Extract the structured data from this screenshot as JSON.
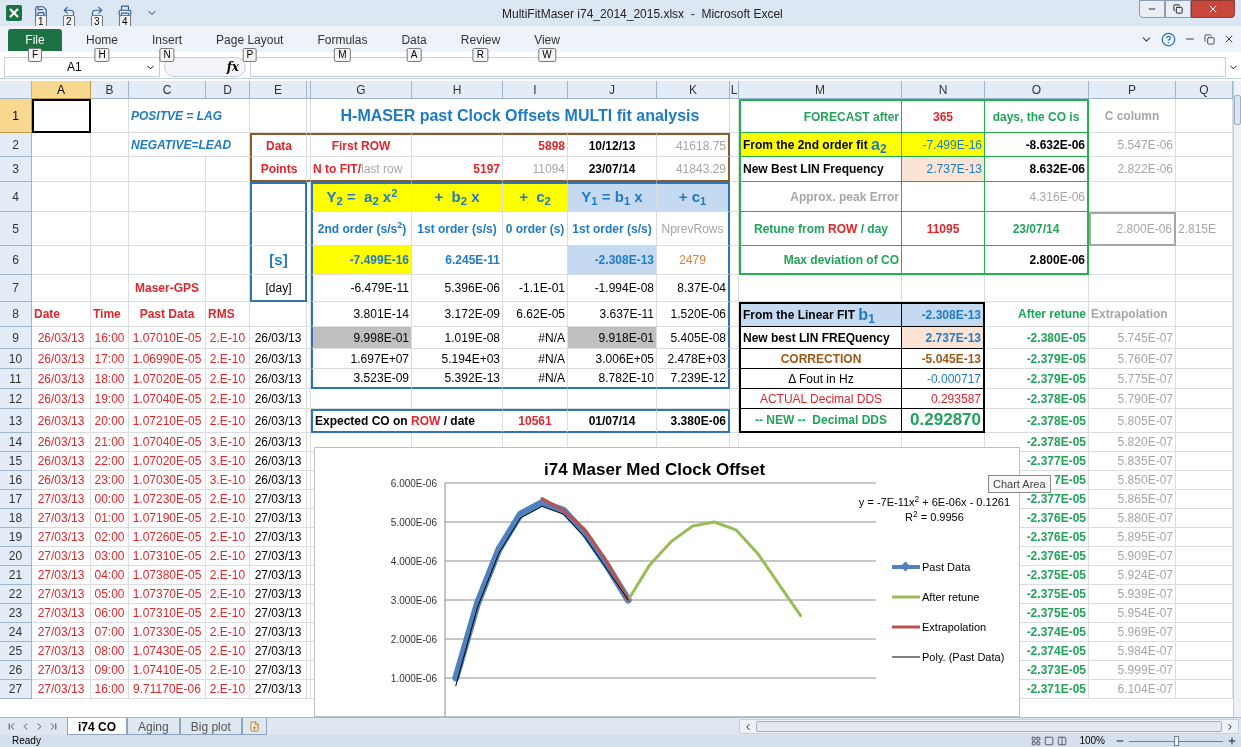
{
  "window": {
    "title": "MultiFitMaser i74_2014_2015.xlsx  -  Microsoft Excel"
  },
  "quick_access": [
    {
      "keytip": "1"
    },
    {
      "keytip": "2"
    },
    {
      "keytip": "3"
    },
    {
      "keytip": "4"
    }
  ],
  "ribbon_tabs": [
    {
      "label": "File",
      "keytip": "F",
      "kind": "file"
    },
    {
      "label": "Home",
      "keytip": "H",
      "kind": "tab"
    },
    {
      "label": "Insert",
      "keytip": "N",
      "kind": "tab"
    },
    {
      "label": "Page Layout",
      "keytip": "P",
      "kind": "tab"
    },
    {
      "label": "Formulas",
      "keytip": "M",
      "kind": "tab"
    },
    {
      "label": "Data",
      "keytip": "A",
      "kind": "tab"
    },
    {
      "label": "Review",
      "keytip": "R",
      "kind": "tab"
    },
    {
      "label": "View",
      "keytip": "W",
      "kind": "tab"
    }
  ],
  "name_box": "A1",
  "function_button": "fx",
  "columns": [
    {
      "label": "A",
      "selected": true
    },
    {
      "label": "B",
      "selected": false
    },
    {
      "label": "C",
      "selected": false
    },
    {
      "label": "D",
      "selected": false
    },
    {
      "label": "E",
      "selected": false
    },
    {
      "label": "G",
      "selected": false
    },
    {
      "label": "H",
      "selected": false
    },
    {
      "label": "I",
      "selected": false
    },
    {
      "label": "J",
      "selected": false
    },
    {
      "label": "K",
      "selected": false
    },
    {
      "label": "L",
      "selected": false
    },
    {
      "label": "M",
      "selected": false
    },
    {
      "label": "N",
      "selected": false
    },
    {
      "label": "O",
      "selected": false
    },
    {
      "label": "P",
      "selected": false
    },
    {
      "label": "Q",
      "selected": false
    }
  ],
  "rows": [
    {
      "number": "1",
      "selected": true,
      "cells": {
        "C": "POSITVE = LAG",
        "G": "H-MASER past Clock Offsets MULTI fit analysis",
        "M": "FORECAST after",
        "N": "365",
        "O": "days, the CO is",
        "P": "C column"
      }
    },
    {
      "number": "2",
      "selected": false,
      "cells": {
        "C": "NEGATIVE=LEAD",
        "E": "Data",
        "G": "First ROW",
        "I": "5898",
        "J": "10/12/13",
        "K": "41618.75",
        "M": [
          "From the 2nd order fit ",
          "a$_{2}$"
        ],
        "N": "-7.499E-16",
        "O": "-8.632E-06",
        "P": "5.547E-06"
      }
    },
    {
      "number": "3",
      "selected": false,
      "cells": {
        "E": "Points",
        "G": [
          "N to FIT/",
          "last row"
        ],
        "H": "5197",
        "I": "11094",
        "J": "23/07/14",
        "K": "41843.29",
        "M": "New Best LIN Frequency",
        "N": "2.737E-13",
        "O": "8.632E-06",
        "P": "2.822E-06"
      }
    },
    {
      "number": "4",
      "selected": false,
      "cells": {
        "G": "Y$_{2}$ =  a$_{2}$ x$^{2}$",
        "H": "+  b$_{2}$ x",
        "I": "+  c$_{2}$",
        "J": "Y$_{1}$ = b$_{1}$ x",
        "K": "+ c$_{1}$",
        "M": "Approx. peak Error",
        "O": "4.316E-06"
      }
    },
    {
      "number": "5",
      "selected": false,
      "cells": {
        "G": "2nd order (s/s$^{2}$)",
        "H": "1st order (s/s)",
        "I": "0 order (s)",
        "J": "1st order (s/s)",
        "K": "NprevRows",
        "M": [
          "Retune from ",
          "ROW",
          " / day"
        ],
        "N": "11095",
        "O": "23/07/14",
        "P": "2.800E-06",
        "Q": "2.815E"
      }
    },
    {
      "number": "6",
      "selected": false,
      "cells": {
        "E": "[s]",
        "G": "-7.499E-16",
        "H": "6.245E-11",
        "J": "-2.308E-13",
        "K": "2479",
        "M": "Max deviation of CO",
        "O": "2.800E-06"
      }
    },
    {
      "number": "7",
      "selected": false,
      "cells": {
        "C": "Maser-GPS",
        "E": "[day]",
        "G": "-6.479E-11",
        "H": "5.396E-06",
        "I": "-1.1E-01",
        "J": "-1.994E-08",
        "K": "8.37E-04"
      }
    },
    {
      "number": "8",
      "selected": false,
      "cells": {
        "A": "Date",
        "B": "Time",
        "C": "Past Data",
        "D": "RMS",
        "G": "3.801E-14",
        "H": "3.172E-09",
        "I": "6.62E-05",
        "J": "3.637E-11",
        "K": "1.520E-06",
        "M": [
          "From the Linear FIT ",
          "b$_{1}$"
        ],
        "N": "-2.308E-13",
        "O": "After retune",
        "P": "Extrapolation"
      }
    },
    {
      "number": "9",
      "selected": false,
      "cells": {
        "A": "26/03/13",
        "B": "16:00",
        "C": "1.07010E-05",
        "D": "2.E-10",
        "E": "26/03/13",
        "G": "9.998E-01",
        "H": "1.019E-08",
        "I": "#N/A",
        "J": "9.918E-01",
        "K": "5.405E-08",
        "M": "New best LIN FREQuency",
        "N": "2.737E-13",
        "O": "-2.380E-05",
        "P": "5.745E-07"
      }
    },
    {
      "number": "10",
      "selected": false,
      "cells": {
        "A": "26/03/13",
        "B": "17:00",
        "C": "1.06990E-05",
        "D": "2.E-10",
        "E": "26/03/13",
        "G": "1.697E+07",
        "H": "5.194E+03",
        "I": "#N/A",
        "J": "3.006E+05",
        "K": "2.478E+03",
        "M": "CORRECTION",
        "N": "-5.045E-13",
        "O": "-2.379E-05",
        "P": "5.760E-07"
      }
    },
    {
      "number": "11",
      "selected": false,
      "cells": {
        "A": "26/03/13",
        "B": "18:00",
        "C": "1.07020E-05",
        "D": "2.E-10",
        "E": "26/03/13",
        "G": "3.523E-09",
        "H": "5.392E-13",
        "I": "#N/A",
        "J": "8.782E-10",
        "K": "7.239E-12",
        "M": "Δ Fout in Hz",
        "N": "-0.000717",
        "O": "-2.379E-05",
        "P": "5.775E-07"
      }
    },
    {
      "number": "12",
      "selected": false,
      "cells": {
        "A": "26/03/13",
        "B": "19:00",
        "C": "1.07040E-05",
        "D": "2.E-10",
        "E": "26/03/13",
        "M": "ACTUAL Decimal DDS",
        "N": "0.293587",
        "O": "-2.378E-05",
        "P": "5.790E-07"
      }
    },
    {
      "number": "13",
      "selected": false,
      "cells": {
        "A": "26/03/13",
        "B": "20:00",
        "C": "1.07210E-05",
        "D": "2.E-10",
        "E": "26/03/13",
        "G": [
          "Expected CO on ",
          "ROW",
          " / date"
        ],
        "I": "10561",
        "J": "01/07/14",
        "K": "3.380E-06",
        "M": "-- NEW --  Decimal DDS",
        "N": "0.292870",
        "O": "-2.378E-05",
        "P": "5.805E-07"
      }
    },
    {
      "number": "14",
      "selected": false,
      "cells": {
        "A": "26/03/13",
        "B": "21:00",
        "C": "1.07040E-05",
        "D": "3.E-10",
        "E": "26/03/13",
        "O": "-2.378E-05",
        "P": "5.820E-07"
      }
    },
    {
      "number": "15",
      "selected": false,
      "cells": {
        "A": "26/03/13",
        "B": "22:00",
        "C": "1.07020E-05",
        "D": "3.E-10",
        "E": "26/03/13",
        "O": "-2.377E-05",
        "P": "5.835E-07"
      }
    },
    {
      "number": "16",
      "selected": false,
      "cells": {
        "A": "26/03/13",
        "B": "23:00",
        "C": "1.07030E-05",
        "D": "3.E-10",
        "E": "26/03/13",
        "O": "7E-05",
        "P": "5.850E-07"
      }
    },
    {
      "number": "17",
      "selected": false,
      "cells": {
        "A": "27/03/13",
        "B": "00:00",
        "C": "1.07230E-05",
        "D": "2.E-10",
        "E": "27/03/13",
        "O": "-2.377E-05",
        "P": "5.865E-07"
      }
    },
    {
      "number": "18",
      "selected": false,
      "cells": {
        "A": "27/03/13",
        "B": "01:00",
        "C": "1.07190E-05",
        "D": "2.E-10",
        "E": "27/03/13",
        "O": "-2.376E-05",
        "P": "5.880E-07"
      }
    },
    {
      "number": "19",
      "selected": false,
      "cells": {
        "A": "27/03/13",
        "B": "02:00",
        "C": "1.07260E-05",
        "D": "2.E-10",
        "E": "27/03/13",
        "O": "-2.376E-05",
        "P": "5.895E-07"
      }
    },
    {
      "number": "20",
      "selected": false,
      "cells": {
        "A": "27/03/13",
        "B": "03:00",
        "C": "1.07310E-05",
        "D": "2.E-10",
        "E": "27/03/13",
        "O": "-2.376E-05",
        "P": "5.909E-07"
      }
    },
    {
      "number": "21",
      "selected": false,
      "cells": {
        "A": "27/03/13",
        "B": "04:00",
        "C": "1.07380E-05",
        "D": "2.E-10",
        "E": "27/03/13",
        "O": "-2.375E-05",
        "P": "5.924E-07"
      }
    },
    {
      "number": "22",
      "selected": false,
      "cells": {
        "A": "27/03/13",
        "B": "05:00",
        "C": "1.07370E-05",
        "D": "2.E-10",
        "E": "27/03/13",
        "O": "-2.375E-05",
        "P": "5.939E-07"
      }
    },
    {
      "number": "23",
      "selected": false,
      "cells": {
        "A": "27/03/13",
        "B": "06:00",
        "C": "1.07310E-05",
        "D": "2.E-10",
        "E": "27/03/13",
        "O": "-2.375E-05",
        "P": "5.954E-07"
      }
    },
    {
      "number": "24",
      "selected": false,
      "cells": {
        "A": "27/03/13",
        "B": "07:00",
        "C": "1.07330E-05",
        "D": "2.E-10",
        "E": "27/03/13",
        "O": "-2.374E-05",
        "P": "5.969E-07"
      }
    },
    {
      "number": "25",
      "selected": false,
      "cells": {
        "A": "27/03/13",
        "B": "08:00",
        "C": "1.07430E-05",
        "D": "2.E-10",
        "E": "27/03/13",
        "O": "-2.374E-05",
        "P": "5.984E-07"
      }
    },
    {
      "number": "26",
      "selected": false,
      "cells": {
        "A": "27/03/13",
        "B": "09:00",
        "C": "1.07410E-05",
        "D": "2.E-10",
        "E": "27/03/13",
        "O": "-2.373E-05",
        "P": "5.999E-07"
      }
    },
    {
      "number": "27",
      "selected": false,
      "cells": {
        "A": "27/03/13",
        "B": "16:00",
        "C": "9.71170E-06",
        "D": "2.E-10",
        "E": "27/03/13",
        "O": "-2.371E-05",
        "P": "6.104E-07"
      }
    }
  ],
  "chart": {
    "tooltip": "Chart Area",
    "chart_data": {
      "type": "line",
      "title": "i74 Maser Med Clock Offset",
      "categories": [
        null,
        null,
        null,
        null,
        null,
        null,
        null,
        null,
        null,
        null,
        null,
        null,
        null,
        null,
        null,
        null,
        null,
        null,
        null,
        null
      ],
      "ylim": [
        0,
        6e-06
      ],
      "grid": true,
      "legend": "right",
      "yticks": [
        {
          "value": 1e-06,
          "label": "1.000E-06"
        },
        {
          "value": 2e-06,
          "label": "2.000E-06"
        },
        {
          "value": 3e-06,
          "label": "3.000E-06"
        },
        {
          "value": 4e-06,
          "label": "4.000E-06"
        },
        {
          "value": 5e-06,
          "label": "5.000E-06"
        },
        {
          "value": 6e-06,
          "label": "6.000E-06"
        }
      ],
      "series": [
        {
          "name": "Past Data",
          "color": "#4f81bd",
          "values": [
            1e-06,
            2.9e-06,
            4.3e-06,
            5.2e-06,
            5.5e-06,
            5.3e-06,
            4.7e-06,
            3.9e-06,
            3e-06,
            null,
            null,
            null,
            null,
            null,
            null,
            null,
            null,
            null,
            null,
            null
          ]
        },
        {
          "name": "After retune",
          "color": "#9bbb59",
          "values": [
            null,
            null,
            null,
            null,
            null,
            null,
            null,
            null,
            3e-06,
            3.9e-06,
            4.5e-06,
            4.9e-06,
            5e-06,
            4.8e-06,
            4.2e-06,
            3.4e-06,
            2.6e-06,
            null,
            null,
            null
          ]
        },
        {
          "name": "Extrapolation",
          "color": "#c0504d",
          "values": [
            null,
            null,
            null,
            null,
            5.6e-06,
            5.3e-06,
            4.8e-06,
            4e-06,
            3e-06,
            null,
            null,
            null,
            null,
            null,
            null,
            null,
            null,
            null,
            null,
            null
          ]
        },
        {
          "name": "Poly. (Past Data)",
          "color": "#000000",
          "values": [
            8e-07,
            2.8e-06,
            4.2e-06,
            5.1e-06,
            5.4e-06,
            5.2e-06,
            4.6e-06,
            3.8e-06,
            3e-06,
            null,
            null,
            null,
            null,
            null,
            null,
            null,
            null,
            null,
            null,
            null
          ]
        }
      ],
      "annotations": [
        "y = -7E-11x$^{2}$ + 6E-06x - 0.1261",
        "R$^{2}$ = 0.9956"
      ]
    }
  },
  "sheet_tabs": [
    {
      "label": "i74 CO",
      "selected": true
    },
    {
      "label": "Aging",
      "selected": false
    },
    {
      "label": "Big plot",
      "selected": false
    }
  ],
  "status_bar": {
    "text": "Ready",
    "zoom": "100%",
    "zoom_slider": {
      "level": 0.5
    }
  }
}
